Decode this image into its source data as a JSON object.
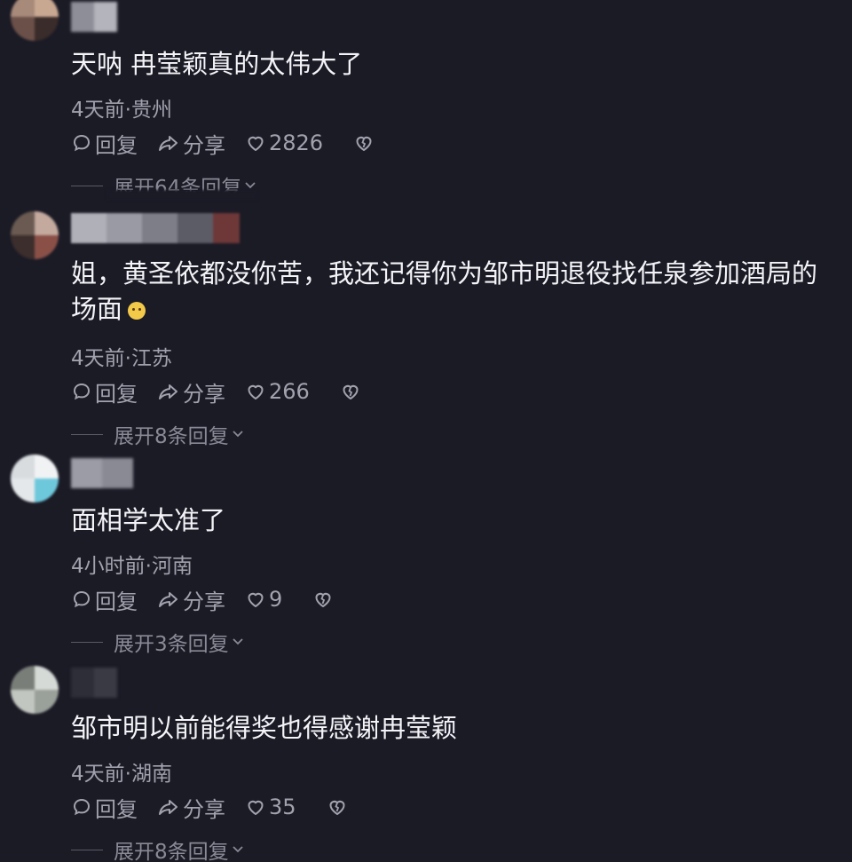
{
  "comments": [
    {
      "text_lines": [
        "天呐 冉莹颖真的太伟大了"
      ],
      "meta": "4天前·贵州",
      "reply_label": "回复",
      "share_label": "分享",
      "likes": "2826",
      "expand_label": "展开64条回复"
    },
    {
      "text_lines": [
        "姐，黄圣依都没你苦，我还记得你为邹市明退役找任泉参加酒局的",
        "场面"
      ],
      "meta": "4天前·江苏",
      "reply_label": "回复",
      "share_label": "分享",
      "likes": "266",
      "expand_label": "展开8条回复"
    },
    {
      "text_lines": [
        "面相学太准了"
      ],
      "meta": "4小时前·河南",
      "reply_label": "回复",
      "share_label": "分享",
      "likes": "9",
      "expand_label": "展开3条回复"
    },
    {
      "text_lines": [
        "邹市明以前能得奖也得感谢冉莹颖"
      ],
      "meta": "4天前·湖南",
      "reply_label": "回复",
      "share_label": "分享",
      "likes": "35",
      "expand_label": "展开8条回复"
    }
  ],
  "icons": {
    "reply": "comment-bubble-icon",
    "share": "share-arrow-icon",
    "like": "heart-icon",
    "dislike": "broken-heart-icon",
    "expand": "chevron-down-icon"
  },
  "colors": {
    "background": "#1b1b26",
    "text": "#f4f4f8",
    "secondary": "#a2a2ae"
  }
}
